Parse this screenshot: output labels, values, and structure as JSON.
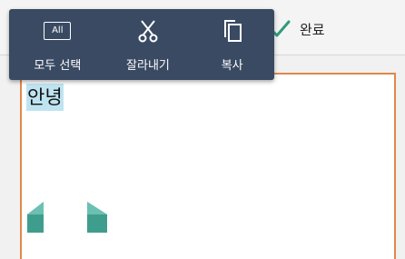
{
  "toolbar": {
    "done_label": "완료"
  },
  "context_menu": {
    "items": [
      {
        "label": "모두 선택",
        "icon": "select-all-icon",
        "icon_text": "All"
      },
      {
        "label": "잘라내기",
        "icon": "scissors-icon"
      },
      {
        "label": "복사",
        "icon": "copy-icon"
      }
    ]
  },
  "editor": {
    "selected_text": "안녕"
  },
  "colors": {
    "menu_background": "#3a4a63",
    "selection_highlight": "#bfe4f1",
    "editor_border": "#e0894a",
    "handle": "#3f9d8e",
    "check": "#2f9a7c"
  }
}
